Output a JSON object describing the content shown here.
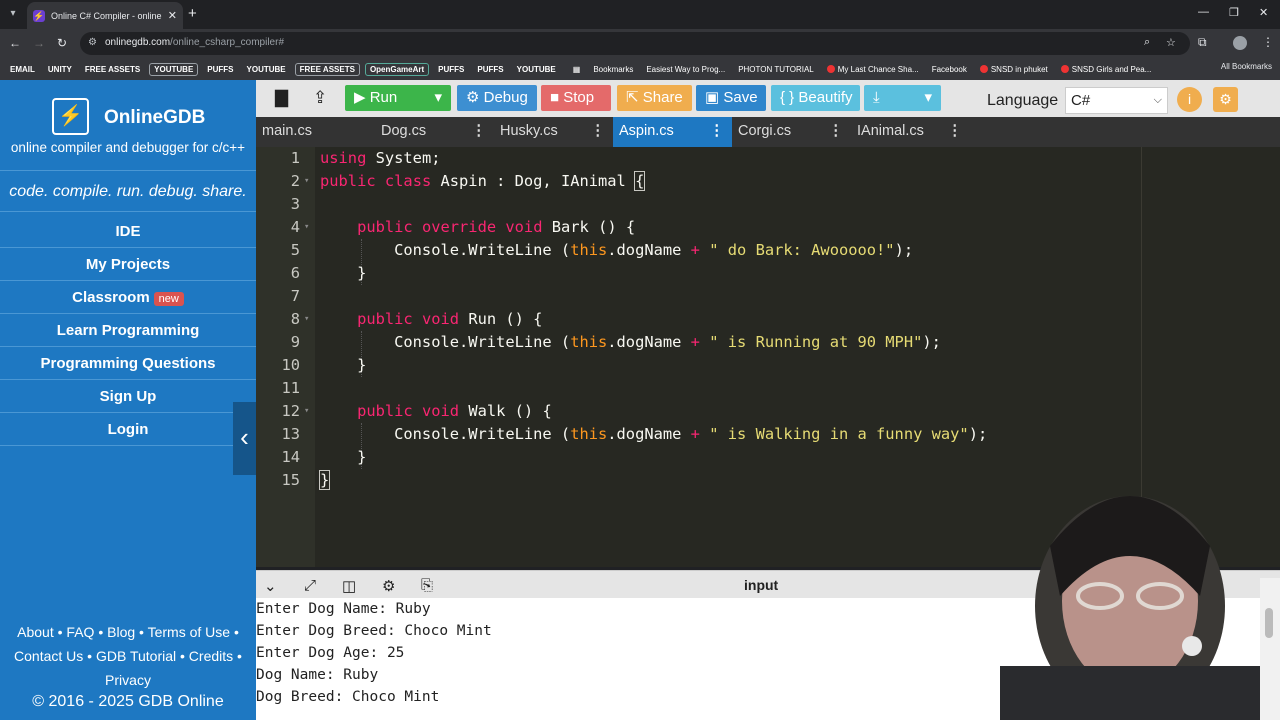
{
  "browser": {
    "tab_title": "Online C# Compiler - online ed",
    "url_host": "onlinegdb.com",
    "url_path": "/online_csharp_compiler#",
    "bookmarks": [
      "EMAIL",
      "UNITY",
      "FREE ASSETS",
      "YOUTUBE",
      "PUFFS",
      "YOUTUBE",
      "FREE ASSETS",
      "OpenGameArt",
      "PUFFS",
      "PUFFS",
      "YOUTUBE"
    ],
    "bookmarks_named": [
      "Bookmarks",
      "Easiest Way to Prog...",
      "PHOTON TUTORIAL",
      "My Last Chance Sha...",
      "Facebook",
      "SNSD in phuket",
      "SNSD Girls and Pea..."
    ],
    "all_bookmarks": "All Bookmarks"
  },
  "sidebar": {
    "brand": "OnlineGDB",
    "tagline": "online compiler and debugger for c/c++",
    "slogan": "code. compile. run. debug. share.",
    "menu": [
      "IDE",
      "My Projects",
      "Classroom",
      "Learn Programming",
      "Programming Questions",
      "Sign Up",
      "Login"
    ],
    "new_badge": "new",
    "footer_line1": [
      "About",
      "FAQ",
      "Blog",
      "Terms of Use"
    ],
    "footer_line2": [
      "Contact Us",
      "GDB Tutorial",
      "Credits"
    ],
    "footer_line3": "Privacy",
    "copyright": "© 2016 - 2025 GDB Online"
  },
  "ide_toolbar": {
    "run": "Run",
    "debug": "Debug",
    "stop": "Stop",
    "share": "Share",
    "save": "Save",
    "beautify": "{ } Beautify",
    "language_label": "Language",
    "language_value": "C#",
    "colors": {
      "run": "#3cb54a",
      "debug": "#3d8fd1",
      "stop": "#e46a6a",
      "share": "#f0ad4e",
      "save": "#2f86cc",
      "beautify": "#5bc0de",
      "download": "#5bc0de"
    }
  },
  "file_tabs": [
    "main.cs",
    "Dog.cs",
    "Husky.cs",
    "Aspin.cs",
    "Corgi.cs",
    "IAnimal.cs"
  ],
  "active_tab": "Aspin.cs",
  "editor": {
    "line_numbers": [
      "1",
      "2",
      "3",
      "4",
      "5",
      "6",
      "7",
      "8",
      "9",
      "10",
      "11",
      "12",
      "13",
      "14",
      "15"
    ]
  },
  "input_panel": {
    "title": "input",
    "lines": [
      "Enter Dog Name: Ruby",
      "Enter Dog Breed: Choco Mint",
      "Enter Dog Age: 25",
      "Dog Name: Ruby",
      "Dog Breed: Choco Mint"
    ]
  }
}
